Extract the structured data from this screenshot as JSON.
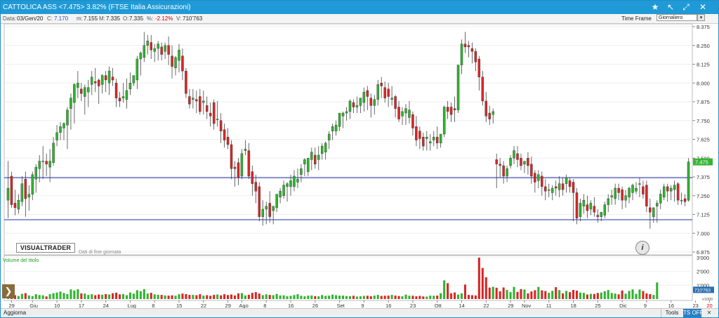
{
  "window": {
    "title": "CATTOLICA ASS <7.475> 3.82%  (FTSE Italia Assicurazioni)",
    "controls": [
      "star-icon",
      "pin-icon",
      "maximize-icon",
      "close-icon"
    ]
  },
  "info": {
    "data_label": "Data:",
    "data_value": "03/Gen/20",
    "c_label": "C:",
    "c_value": "7.170",
    "m_label": "m:",
    "m_value": "7.155",
    "max_label": "M:",
    "max_value": "7.335",
    "o_label": "O:",
    "o_value": "7.335",
    "pct_label": "%:",
    "pct_value": "-2.12%",
    "v_label": "V:",
    "v_value": "710'763",
    "timeframe_label": "Time Frame",
    "timeframe_value": "Giornaliero"
  },
  "branding": {
    "logo": "VISUALTRADER",
    "eod_note": "Dati di fine giornata"
  },
  "volume_panel": {
    "title": "Volume del titolo"
  },
  "status": {
    "aggiorna": "Aggiorna",
    "tools": "Tools",
    "ts_off": "TS OFF"
  },
  "colors": {
    "up": "#2fb42f",
    "down": "#d92626",
    "hline": "#1a2fb0",
    "accent": "#1f9ad6",
    "last_tag": "#35b535"
  },
  "chart_data": {
    "type": "candlestick",
    "y_axis": {
      "ylim": [
        6.875,
        8.375
      ],
      "ticks": [
        "8.375",
        "8.250",
        "8.125",
        "8.000",
        "7.875",
        "7.750",
        "7.625",
        "7.500",
        "7.375",
        "7.250",
        "7.125",
        "7.000",
        "6.875"
      ]
    },
    "volume_axis": {
      "ticks": [
        "3'000",
        "2'000",
        "1'000"
      ],
      "unit_label": "x1000",
      "last_value_label": "710'763"
    },
    "last_price": "7.475",
    "horizontal_lines": [
      7.37,
      7.09
    ],
    "x_labels": [
      {
        "i": 1,
        "t": "29"
      },
      {
        "i": 7,
        "t": "Giu"
      },
      {
        "i": 14,
        "t": "10"
      },
      {
        "i": 21,
        "t": "17"
      },
      {
        "i": 28,
        "t": "24"
      },
      {
        "i": 35,
        "t": "Lug"
      },
      {
        "i": 42,
        "t": "8"
      },
      {
        "i": 49,
        "t": "15"
      },
      {
        "i": 56,
        "t": "22"
      },
      {
        "i": 63,
        "t": "29"
      },
      {
        "i": 67,
        "t": "Ago"
      },
      {
        "i": 74,
        "t": "8"
      },
      {
        "i": 81,
        "t": "16"
      },
      {
        "i": 88,
        "t": "26"
      },
      {
        "i": 95,
        "t": "Set"
      },
      {
        "i": 102,
        "t": "9"
      },
      {
        "i": 109,
        "t": "16"
      },
      {
        "i": 116,
        "t": "23"
      },
      {
        "i": 123,
        "t": "Ott"
      },
      {
        "i": 130,
        "t": "14"
      },
      {
        "i": 137,
        "t": "22"
      },
      {
        "i": 144,
        "t": "29"
      },
      {
        "i": 148,
        "t": "Nov"
      },
      {
        "i": 155,
        "t": "11"
      },
      {
        "i": 162,
        "t": "18"
      },
      {
        "i": 169,
        "t": "25"
      },
      {
        "i": 176,
        "t": "Dic"
      },
      {
        "i": 183,
        "t": "9"
      },
      {
        "i": 190,
        "t": "16"
      },
      {
        "i": 197,
        "t": "23"
      },
      {
        "i": 201,
        "t": "20",
        "red": true
      },
      {
        "i": 207,
        "t": "9"
      },
      {
        "i": 214,
        "t": "16"
      }
    ],
    "candles": [
      [
        7.22,
        7.48,
        7.3,
        7.1
      ],
      [
        7.38,
        7.41,
        7.19,
        7.17
      ],
      [
        7.2,
        7.29,
        7.17,
        7.12
      ],
      [
        7.16,
        7.26,
        7.22,
        7.13
      ],
      [
        7.21,
        7.38,
        7.33,
        7.18
      ],
      [
        7.36,
        7.41,
        7.23,
        7.11
      ],
      [
        7.24,
        7.32,
        7.26,
        7.15
      ],
      [
        7.26,
        7.41,
        7.39,
        7.22
      ],
      [
        7.36,
        7.46,
        7.44,
        7.27
      ],
      [
        7.43,
        7.52,
        7.48,
        7.34
      ],
      [
        7.48,
        7.58,
        7.48,
        7.36
      ],
      [
        7.48,
        7.53,
        7.46,
        7.38
      ],
      [
        7.44,
        7.56,
        7.48,
        7.34
      ],
      [
        7.47,
        7.64,
        7.6,
        7.45
      ],
      [
        7.62,
        7.72,
        7.67,
        7.58
      ],
      [
        7.67,
        7.74,
        7.71,
        7.62
      ],
      [
        7.7,
        7.74,
        7.73,
        7.62
      ],
      [
        7.72,
        7.84,
        7.82,
        7.56
      ],
      [
        7.83,
        7.93,
        7.9,
        7.69
      ],
      [
        7.87,
        8.0,
        7.99,
        7.73
      ],
      [
        7.97,
        8.08,
        8.0,
        7.9
      ],
      [
        7.96,
        8.0,
        7.93,
        7.88
      ],
      [
        7.91,
        7.99,
        7.97,
        7.79
      ],
      [
        7.94,
        8.02,
        7.97,
        7.84
      ],
      [
        7.99,
        8.08,
        8.04,
        7.92
      ],
      [
        8.01,
        8.1,
        8.0,
        7.94
      ],
      [
        8.02,
        8.03,
        7.98,
        7.86
      ],
      [
        7.99,
        8.06,
        8.05,
        7.93
      ],
      [
        8.05,
        8.08,
        8.02,
        7.94
      ],
      [
        8.0,
        8.11,
        8.08,
        7.92
      ],
      [
        8.04,
        8.1,
        8.02,
        7.98
      ],
      [
        8.0,
        8.03,
        7.9,
        7.84
      ],
      [
        7.9,
        7.94,
        7.88,
        7.84
      ],
      [
        7.9,
        8.0,
        7.91,
        7.87
      ],
      [
        7.89,
        8.03,
        7.95,
        7.83
      ],
      [
        7.96,
        8.07,
        8.0,
        7.92
      ],
      [
        8.0,
        8.05,
        8.05,
        7.98
      ],
      [
        8.02,
        8.18,
        8.16,
        7.96
      ],
      [
        8.16,
        8.21,
        8.2,
        8.05
      ],
      [
        8.17,
        8.34,
        8.25,
        8.14
      ],
      [
        8.25,
        8.32,
        8.28,
        8.19
      ],
      [
        8.27,
        8.32,
        8.22,
        8.16
      ],
      [
        8.21,
        8.26,
        8.23,
        8.14
      ],
      [
        8.23,
        8.28,
        8.26,
        8.15
      ],
      [
        8.24,
        8.27,
        8.19,
        8.15
      ],
      [
        8.21,
        8.27,
        8.25,
        8.16
      ],
      [
        8.25,
        8.31,
        8.19,
        8.12
      ],
      [
        8.18,
        8.25,
        8.11,
        8.03
      ],
      [
        8.1,
        8.18,
        8.17,
        8.05
      ],
      [
        8.15,
        8.26,
        8.22,
        8.07
      ],
      [
        8.18,
        8.23,
        8.08,
        8.02
      ],
      [
        8.08,
        8.1,
        7.93,
        7.9
      ],
      [
        7.91,
        7.96,
        7.86,
        7.83
      ],
      [
        7.89,
        7.96,
        7.9,
        7.83
      ],
      [
        7.89,
        7.95,
        7.88,
        7.8
      ],
      [
        7.91,
        7.96,
        7.81,
        7.79
      ],
      [
        7.87,
        7.95,
        7.88,
        7.79
      ],
      [
        7.85,
        7.91,
        7.81,
        7.76
      ],
      [
        7.8,
        7.87,
        7.78,
        7.71
      ],
      [
        7.87,
        7.89,
        7.73,
        7.69
      ],
      [
        7.76,
        7.88,
        7.76,
        7.71
      ],
      [
        7.75,
        7.8,
        7.68,
        7.6
      ],
      [
        7.69,
        7.73,
        7.62,
        7.57
      ],
      [
        7.64,
        7.7,
        7.59,
        7.56
      ],
      [
        7.59,
        7.62,
        7.43,
        7.36
      ],
      [
        7.44,
        7.48,
        7.43,
        7.31
      ],
      [
        7.47,
        7.5,
        7.37,
        7.32
      ],
      [
        7.38,
        7.56,
        7.53,
        7.36
      ],
      [
        7.55,
        7.62,
        7.56,
        7.52
      ],
      [
        7.55,
        7.6,
        7.38,
        7.36
      ],
      [
        7.41,
        7.45,
        7.33,
        7.25
      ],
      [
        7.34,
        7.39,
        7.28,
        7.2
      ],
      [
        7.31,
        7.34,
        7.11,
        7.08
      ],
      [
        7.11,
        7.22,
        7.16,
        7.05
      ],
      [
        7.16,
        7.21,
        7.18,
        7.06
      ],
      [
        7.2,
        7.28,
        7.11,
        7.07
      ],
      [
        7.15,
        7.18,
        7.18,
        7.06
      ],
      [
        7.17,
        7.25,
        7.26,
        7.14
      ],
      [
        7.24,
        7.3,
        7.28,
        7.2
      ],
      [
        7.25,
        7.35,
        7.32,
        7.23
      ],
      [
        7.31,
        7.34,
        7.33,
        7.21
      ],
      [
        7.31,
        7.39,
        7.35,
        7.25
      ],
      [
        7.31,
        7.42,
        7.38,
        7.28
      ],
      [
        7.34,
        7.43,
        7.36,
        7.3
      ],
      [
        7.39,
        7.46,
        7.43,
        7.34
      ],
      [
        7.46,
        7.5,
        7.49,
        7.38
      ],
      [
        7.41,
        7.49,
        7.5,
        7.38
      ],
      [
        7.49,
        7.57,
        7.54,
        7.42
      ],
      [
        7.52,
        7.57,
        7.46,
        7.43
      ],
      [
        7.49,
        7.58,
        7.52,
        7.42
      ],
      [
        7.53,
        7.6,
        7.58,
        7.49
      ],
      [
        7.54,
        7.61,
        7.6,
        7.49
      ],
      [
        7.62,
        7.68,
        7.66,
        7.56
      ],
      [
        7.68,
        7.73,
        7.71,
        7.62
      ],
      [
        7.68,
        7.75,
        7.72,
        7.65
      ],
      [
        7.71,
        7.77,
        7.8,
        7.68
      ],
      [
        7.78,
        7.81,
        7.8,
        7.7
      ],
      [
        7.8,
        7.84,
        7.81,
        7.75
      ],
      [
        7.81,
        7.89,
        7.88,
        7.76
      ],
      [
        7.87,
        7.89,
        7.84,
        7.8
      ],
      [
        7.84,
        7.91,
        7.85,
        7.8
      ],
      [
        7.85,
        7.9,
        7.9,
        7.8
      ],
      [
        7.87,
        7.97,
        7.94,
        7.81
      ],
      [
        7.95,
        7.98,
        7.91,
        7.82
      ],
      [
        7.9,
        7.93,
        7.85,
        7.77
      ],
      [
        7.85,
        7.92,
        7.89,
        7.79
      ],
      [
        7.89,
        8.02,
        7.99,
        7.85
      ],
      [
        8.0,
        8.04,
        7.98,
        7.9
      ],
      [
        7.97,
        8.01,
        7.9,
        7.87
      ],
      [
        7.96,
        8.0,
        7.91,
        7.84
      ],
      [
        7.89,
        7.98,
        7.9,
        7.85
      ],
      [
        7.91,
        7.92,
        7.83,
        7.77
      ],
      [
        7.84,
        7.88,
        7.76,
        7.74
      ],
      [
        7.78,
        7.84,
        7.81,
        7.72
      ],
      [
        7.8,
        7.86,
        7.83,
        7.72
      ],
      [
        7.77,
        7.88,
        7.82,
        7.73
      ],
      [
        7.79,
        7.81,
        7.7,
        7.65
      ],
      [
        7.71,
        7.78,
        7.62,
        7.58
      ],
      [
        7.68,
        7.71,
        7.63,
        7.56
      ],
      [
        7.64,
        7.67,
        7.58,
        7.55
      ],
      [
        7.63,
        7.68,
        7.64,
        7.55
      ],
      [
        7.6,
        7.66,
        7.61,
        7.55
      ],
      [
        7.62,
        7.68,
        7.64,
        7.58
      ],
      [
        7.64,
        7.71,
        7.6,
        7.56
      ],
      [
        7.6,
        7.64,
        7.66,
        7.57
      ],
      [
        7.66,
        7.85,
        7.84,
        7.64
      ],
      [
        7.84,
        7.88,
        7.81,
        7.76
      ],
      [
        7.84,
        7.87,
        7.79,
        7.74
      ],
      [
        7.83,
        7.91,
        7.82,
        7.74
      ],
      [
        7.82,
        7.9,
        8.12,
        7.8
      ],
      [
        8.12,
        8.29,
        8.26,
        8.06
      ],
      [
        8.26,
        8.34,
        8.24,
        8.2
      ],
      [
        8.25,
        8.28,
        8.24,
        8.17
      ],
      [
        8.23,
        8.27,
        8.21,
        8.13
      ],
      [
        8.21,
        8.23,
        8.14,
        8.08
      ],
      [
        8.16,
        8.18,
        8.04,
        7.95
      ],
      [
        8.04,
        8.08,
        7.88,
        7.85
      ],
      [
        7.88,
        7.94,
        7.78,
        7.74
      ],
      [
        7.8,
        7.85,
        7.76,
        7.72
      ],
      [
        7.79,
        7.83,
        7.81,
        7.73
      ],
      [
        7.49,
        7.53,
        7.46,
        7.3
      ],
      [
        7.46,
        7.5,
        7.45,
        7.37
      ],
      [
        7.45,
        7.48,
        7.38,
        7.33
      ],
      [
        7.38,
        7.45,
        7.43,
        7.34
      ],
      [
        7.45,
        7.52,
        7.5,
        7.43
      ],
      [
        7.5,
        7.58,
        7.55,
        7.46
      ],
      [
        7.53,
        7.58,
        7.49,
        7.44
      ],
      [
        7.5,
        7.53,
        7.45,
        7.42
      ],
      [
        7.46,
        7.48,
        7.48,
        7.4
      ],
      [
        7.5,
        7.54,
        7.45,
        7.39
      ],
      [
        7.46,
        7.51,
        7.38,
        7.33
      ],
      [
        7.4,
        7.42,
        7.34,
        7.27
      ],
      [
        7.35,
        7.42,
        7.39,
        7.3
      ],
      [
        7.38,
        7.41,
        7.31,
        7.25
      ],
      [
        7.31,
        7.36,
        7.28,
        7.22
      ],
      [
        7.29,
        7.33,
        7.29,
        7.24
      ],
      [
        7.27,
        7.32,
        7.3,
        7.22
      ],
      [
        7.31,
        7.35,
        7.3,
        7.25
      ],
      [
        7.29,
        7.38,
        7.33,
        7.24
      ],
      [
        7.33,
        7.37,
        7.29,
        7.25
      ],
      [
        7.33,
        7.39,
        7.37,
        7.27
      ],
      [
        7.35,
        7.37,
        7.31,
        7.27
      ],
      [
        7.34,
        7.36,
        7.27,
        7.08
      ],
      [
        7.27,
        7.3,
        7.1,
        7.06
      ],
      [
        7.11,
        7.23,
        7.2,
        7.08
      ],
      [
        7.18,
        7.26,
        7.22,
        7.13
      ],
      [
        7.19,
        7.25,
        7.15,
        7.1
      ],
      [
        7.16,
        7.22,
        7.2,
        7.12
      ],
      [
        7.18,
        7.24,
        7.14,
        7.11
      ],
      [
        7.12,
        7.16,
        7.11,
        7.07
      ],
      [
        7.11,
        7.14,
        7.14,
        7.08
      ],
      [
        7.12,
        7.21,
        7.19,
        7.1
      ],
      [
        7.19,
        7.26,
        7.23,
        7.14
      ],
      [
        7.24,
        7.29,
        7.25,
        7.19
      ],
      [
        7.23,
        7.33,
        7.3,
        7.19
      ],
      [
        7.3,
        7.33,
        7.27,
        7.22
      ],
      [
        7.29,
        7.31,
        7.22,
        7.16
      ],
      [
        7.22,
        7.29,
        7.25,
        7.17
      ],
      [
        7.24,
        7.31,
        7.3,
        7.2
      ],
      [
        7.27,
        7.33,
        7.32,
        7.22
      ],
      [
        7.28,
        7.34,
        7.3,
        7.26
      ],
      [
        7.33,
        7.37,
        7.33,
        7.24
      ],
      [
        7.31,
        7.35,
        7.26,
        7.23
      ],
      [
        7.32,
        7.35,
        7.18,
        7.14
      ],
      [
        7.17,
        7.23,
        7.14,
        7.03
      ],
      [
        7.11,
        7.15,
        7.17,
        7.07
      ],
      [
        7.18,
        7.22,
        7.2,
        7.07
      ],
      [
        7.2,
        7.29,
        7.26,
        7.16
      ],
      [
        7.24,
        7.33,
        7.31,
        7.22
      ],
      [
        7.31,
        7.33,
        7.28,
        7.21
      ],
      [
        7.28,
        7.32,
        7.3,
        7.22
      ],
      [
        7.29,
        7.35,
        7.32,
        7.21
      ],
      [
        7.33,
        7.34,
        7.22,
        7.19
      ],
      [
        7.22,
        7.27,
        7.22,
        7.19
      ],
      [
        7.23,
        7.26,
        7.21,
        7.18
      ],
      [
        7.22,
        7.5,
        7.475,
        7.21
      ]
    ],
    "volume": [
      250,
      300,
      280,
      220,
      380,
      430,
      260,
      210,
      350,
      290,
      270,
      190,
      350,
      420,
      470,
      540,
      440,
      360,
      700,
      620,
      710,
      410,
      400,
      300,
      350,
      280,
      330,
      310,
      360,
      330,
      420,
      460,
      340,
      360,
      280,
      470,
      390,
      640,
      570,
      720,
      400,
      450,
      340,
      310,
      300,
      260,
      250,
      270,
      240,
      350,
      400,
      360,
      300,
      300,
      280,
      350,
      250,
      280,
      240,
      300,
      330,
      270,
      350,
      290,
      330,
      260,
      410,
      430,
      260,
      310,
      450,
      500,
      400,
      280,
      340,
      300,
      280,
      370,
      260,
      270,
      200,
      230,
      290,
      350,
      240,
      200,
      250,
      260,
      210,
      200,
      290,
      230,
      250,
      320,
      280,
      250,
      250,
      220,
      210,
      240,
      180,
      200,
      230,
      240,
      200,
      250,
      300,
      230,
      240,
      250,
      300,
      250,
      220,
      200,
      320,
      240,
      240,
      200,
      230,
      190,
      180,
      250,
      240,
      250,
      420,
      1350,
      1150,
      420,
      480,
      320,
      420,
      1050,
      300,
      280,
      260,
      3000,
      2250,
      1580,
      830,
      890,
      820,
      560,
      840,
      660,
      500,
      880,
      520,
      720,
      690,
      410,
      550,
      640,
      880,
      630,
      580,
      450,
      600,
      860,
      650,
      410,
      590,
      500,
      660,
      610,
      470,
      450,
      330,
      380,
      370,
      440,
      470,
      560,
      650,
      440,
      400,
      340,
      620,
      390,
      590,
      700,
      380,
      690,
      580,
      410,
      360,
      300,
      1200
    ]
  }
}
